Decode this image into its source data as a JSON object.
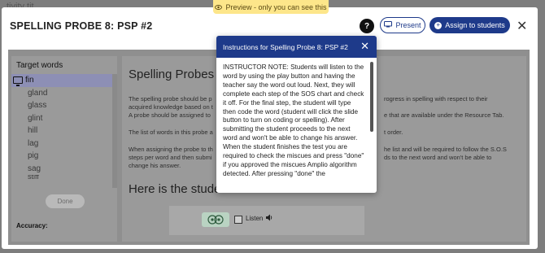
{
  "banner": {
    "text": "Preview - only you can see this",
    "icon": "eye-icon"
  },
  "background": {
    "fragment": "tivity tit"
  },
  "modal": {
    "title": "SPELLING PROBE 8: PSP #2",
    "help_label": "?",
    "present_label": "Present",
    "assign_label": "Assign to students",
    "close_label": "✕"
  },
  "sidebar": {
    "title": "Target words",
    "words": [
      "fin",
      "gland",
      "glass",
      "glint",
      "hill",
      "lag",
      "pig",
      "sag",
      "stiff"
    ],
    "done_label": "Done",
    "accuracy_label": "Accuracy:"
  },
  "article": {
    "heading": "Spelling Probes",
    "p1a": "The spelling probe should be p",
    "p1b": "rogress in spelling with respect to their",
    "p2a": "acquired knowledge based on t",
    "p3a": "A probe should be assigned to",
    "p3b": "e that are available under the Resource Tab.",
    "p4a": "The list of words in this probe a",
    "p4b": "t order.",
    "p5a": "When assigning the probe to th",
    "p5b": "he list and will be required to follow the S.O.S",
    "p6a": "steps per word and then submi",
    "p6b": "ds to the next word and won't be able to",
    "p7": "change his answer.",
    "heading2": "Here is the student",
    "listen_label": "Listen"
  },
  "popover": {
    "title": "Instructions for Spelling Probe 8: PSP #2",
    "close_label": "✕",
    "body": "INSTRUCTOR NOTE: Students will listen to the word by using the play button and having the teacher say the word out loud. Next, they will complete each step of the SOS chart and check it off. For the final step, the student will type then code the word (student will click the slide button to turn on coding or spelling). After submitting the student proceeds to the next word and won't be able to change his answer. When the student finishes the test you are required to check the miscues and press \"done\" if you approved the miscues Amplio algorithm detected. After pressing \"done\" the"
  },
  "colors": {
    "accent": "#1e3a8a",
    "banner": "#fde68a",
    "active_word": "#8d8fb5"
  }
}
